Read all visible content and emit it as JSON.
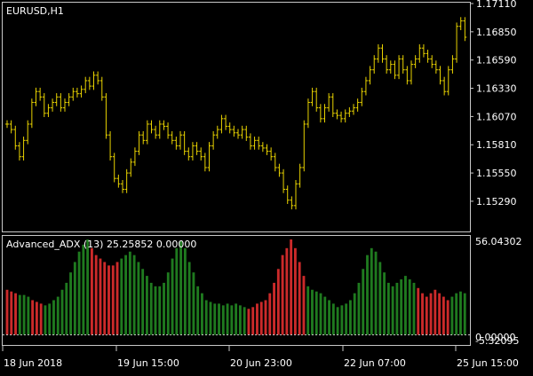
{
  "main_chart": {
    "label": "EURUSD,H1",
    "bar_color": "#e8d200",
    "price_ticks": [
      "1.17110",
      "1.16850",
      "1.16590",
      "1.16330",
      "1.16070",
      "1.15810",
      "1.15550",
      "1.15290"
    ],
    "ylim": [
      1.1502,
      1.1711
    ]
  },
  "indicator": {
    "label": "Advanced_ADX (13) 25.25852 0.00000",
    "level_top": "56.04302",
    "level_zero": "0.00000",
    "level_bottom": "-5.32095",
    "ylim": [
      -5.32095,
      56.04302
    ],
    "colors": {
      "up": "#1f7a1f",
      "down": "#cc2a2a"
    }
  },
  "time_axis": [
    "18 Jun 2018",
    "19 Jun 15:00",
    "20 Jun 23:00",
    "22 Jun 07:00",
    "25 Jun 15:00"
  ],
  "chart_data": [
    {
      "type": "ohlc",
      "title": "EURUSD,H1",
      "ylim": [
        1.1502,
        1.1711
      ],
      "close": [
        1.16,
        1.1595,
        1.158,
        1.157,
        1.1585,
        1.16,
        1.162,
        1.163,
        1.1625,
        1.161,
        1.1615,
        1.162,
        1.1625,
        1.1615,
        1.162,
        1.1625,
        1.163,
        1.1628,
        1.1632,
        1.164,
        1.1635,
        1.1645,
        1.164,
        1.1625,
        1.159,
        1.157,
        1.155,
        1.1545,
        1.154,
        1.1555,
        1.1565,
        1.1575,
        1.159,
        1.1585,
        1.16,
        1.1595,
        1.159,
        1.16,
        1.1598,
        1.159,
        1.1585,
        1.158,
        1.159,
        1.1575,
        1.157,
        1.158,
        1.1575,
        1.157,
        1.156,
        1.158,
        1.159,
        1.1595,
        1.1605,
        1.1598,
        1.1595,
        1.1592,
        1.159,
        1.1595,
        1.1588,
        1.158,
        1.1585,
        1.158,
        1.1578,
        1.1575,
        1.157,
        1.156,
        1.1555,
        1.154,
        1.153,
        1.1525,
        1.1545,
        1.156,
        1.16,
        1.162,
        1.163,
        1.1615,
        1.1605,
        1.1615,
        1.1625,
        1.161,
        1.1608,
        1.1605,
        1.161,
        1.1612,
        1.1615,
        1.162,
        1.163,
        1.164,
        1.165,
        1.166,
        1.167,
        1.166,
        1.165,
        1.1655,
        1.1645,
        1.166,
        1.165,
        1.164,
        1.1655,
        1.166,
        1.167,
        1.1665,
        1.166,
        1.1655,
        1.165,
        1.164,
        1.163,
        1.165,
        1.166,
        1.169,
        1.1695,
        1.168
      ],
      "high_offset": 0.00035,
      "low_offset": 0.00035
    },
    {
      "type": "bar",
      "title": "Advanced_ADX (13) 25.25852 0.00000",
      "ylim": [
        -5.32095,
        56.04302
      ],
      "values": [
        26,
        25,
        24,
        23,
        23,
        22,
        20,
        19,
        18,
        17,
        18,
        20,
        22,
        26,
        30,
        36,
        42,
        48,
        52,
        55,
        50,
        46,
        44,
        42,
        40,
        40,
        42,
        44,
        46,
        48,
        46,
        42,
        38,
        34,
        30,
        28,
        28,
        30,
        36,
        44,
        50,
        54,
        50,
        42,
        36,
        28,
        24,
        20,
        19,
        18,
        18,
        17,
        18,
        17,
        18,
        17,
        16,
        15,
        16,
        18,
        19,
        20,
        24,
        30,
        38,
        46,
        50,
        55,
        50,
        42,
        34,
        28,
        26,
        25,
        24,
        22,
        20,
        18,
        16,
        17,
        18,
        20,
        24,
        30,
        38,
        46,
        50,
        48,
        42,
        36,
        30,
        28,
        30,
        32,
        34,
        32,
        30,
        27,
        24,
        22,
        24,
        26,
        24,
        22,
        20,
        22,
        24,
        25,
        24
      ],
      "colors": [
        "down",
        "down",
        "down",
        "up",
        "up",
        "up",
        "down",
        "down",
        "down",
        "up",
        "up",
        "up",
        "up",
        "up",
        "up",
        "up",
        "up",
        "up",
        "up",
        "up",
        "down",
        "down",
        "down",
        "down",
        "down",
        "down",
        "down",
        "up",
        "up",
        "up",
        "up",
        "up",
        "up",
        "up",
        "up",
        "up",
        "up",
        "up",
        "up",
        "up",
        "up",
        "up",
        "up",
        "up",
        "up",
        "up",
        "up",
        "up",
        "up",
        "up",
        "up",
        "up",
        "up",
        "up",
        "up",
        "up",
        "up",
        "down",
        "down",
        "down",
        "down",
        "down",
        "down",
        "down",
        "down",
        "down",
        "down",
        "down",
        "down",
        "down",
        "down",
        "up",
        "up",
        "up",
        "up",
        "up",
        "up",
        "up",
        "up",
        "up",
        "up",
        "up",
        "up",
        "up",
        "up",
        "up",
        "up",
        "up",
        "up",
        "up",
        "up",
        "up",
        "up",
        "up",
        "up",
        "up",
        "up",
        "down",
        "down",
        "down",
        "down",
        "down",
        "down",
        "down",
        "down",
        "up",
        "up",
        "up",
        "up"
      ]
    }
  ]
}
